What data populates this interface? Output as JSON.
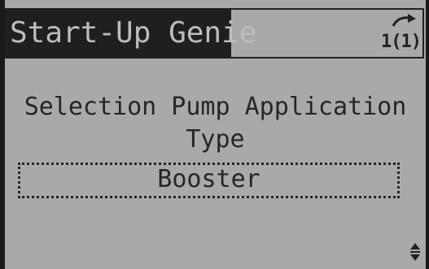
{
  "header": {
    "title": "Start-Up Genie",
    "menu_index": "1(1)"
  },
  "parameter": {
    "label": "Selection Pump Application Type",
    "value": "Booster"
  },
  "icons": {
    "header_arrow": "back-arrow-icon",
    "scroll": "up-down-arrow-icon"
  },
  "colors": {
    "display_background": "#a9a9a9",
    "text": "#262626",
    "title_highlight": "#1f1f1f",
    "title_text": "#bdbdbd"
  }
}
